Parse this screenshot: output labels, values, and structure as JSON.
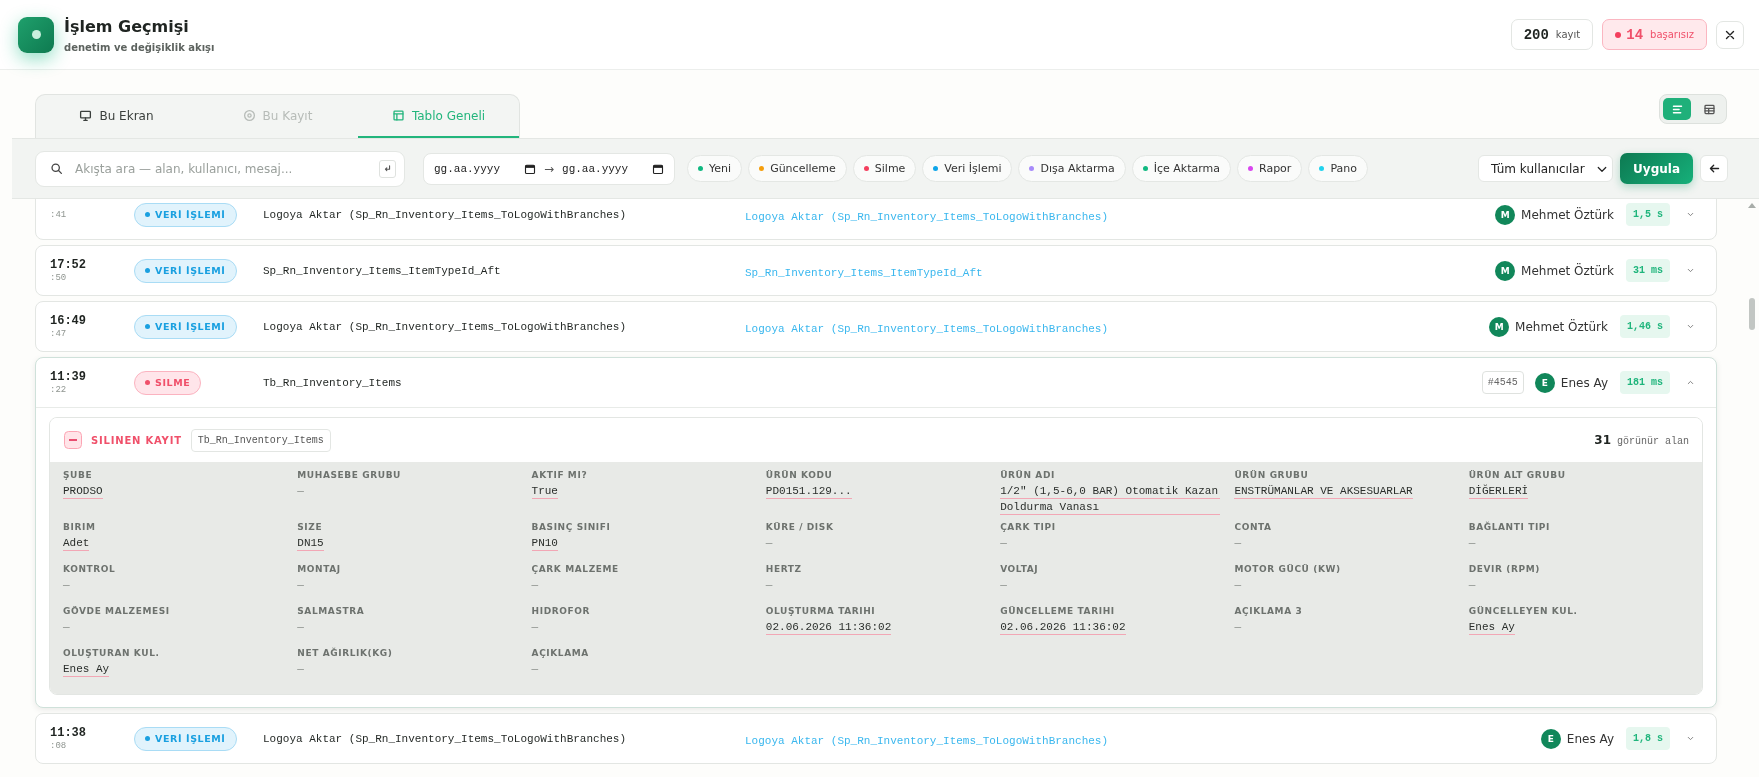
{
  "header": {
    "title": "İşlem Geçmişi",
    "subtitle": "denetim ve değişiklik akışı",
    "count": {
      "value": "200",
      "label": "kayıt"
    },
    "failed": {
      "value": "14",
      "label": "başarısız"
    }
  },
  "tabs": [
    {
      "label": "Bu Ekran",
      "selected": false,
      "disabled": false
    },
    {
      "label": "Bu Kayıt",
      "selected": false,
      "disabled": true
    },
    {
      "label": "Tablo Geneli",
      "selected": true,
      "disabled": false
    }
  ],
  "view_toggle": [
    {
      "selected": true
    },
    {
      "selected": false
    }
  ],
  "filters": {
    "search": {
      "placeholder": "Akışta ara — alan, kullanıcı, mesaj..."
    },
    "date_from": {
      "placeholder": "gg.aa.yyyy"
    },
    "date_separator": "→",
    "date_to": {
      "placeholder": "gg.aa.yyyy"
    },
    "chips": [
      {
        "label": "Yeni",
        "color": "#10b981"
      },
      {
        "label": "Güncelleme",
        "color": "#f59e0b"
      },
      {
        "label": "Silme",
        "color": "#f43f5e"
      },
      {
        "label": "Veri İşlemi",
        "color": "#0ea5e9"
      },
      {
        "label": "Dışa Aktarma",
        "color": "#a78bfa"
      },
      {
        "label": "İçe Aktarma",
        "color": "#10b981"
      },
      {
        "label": "Rapor",
        "color": "#d946ef"
      },
      {
        "label": "Pano",
        "color": "#22d3ee"
      }
    ],
    "user_select": "Tüm kullanıcılar",
    "apply_button": "Uygula"
  },
  "rows": [
    {
      "seconds": ":41",
      "kind": "data",
      "badge": "VERİ İŞLEMİ",
      "name": "Logoya Aktar (Sp_Rn_Inventory_Items_ToLogoWithBranches)",
      "link": "Logoya Aktar (Sp_Rn_Inventory_Items_ToLogoWithBranches)",
      "avatar": "M",
      "user": "Mehmet Öztürk",
      "duration": "1,5 s",
      "expanded": false
    },
    {
      "time": "17:52",
      "seconds": ":50",
      "kind": "data",
      "badge": "VERİ İŞLEMİ",
      "name": "Sp_Rn_Inventory_Items_ItemTypeId_Aft",
      "link": "Sp_Rn_Inventory_Items_ItemTypeId_Aft",
      "avatar": "M",
      "user": "Mehmet Öztürk",
      "duration": "31 ms",
      "expanded": false
    },
    {
      "time": "16:49",
      "seconds": ":47",
      "kind": "data",
      "badge": "VERİ İŞLEMİ",
      "name": "Logoya Aktar (Sp_Rn_Inventory_Items_ToLogoWithBranches)",
      "link": "Logoya Aktar (Sp_Rn_Inventory_Items_ToLogoWithBranches)",
      "avatar": "M",
      "user": "Mehmet Öztürk",
      "duration": "1,46 s",
      "expanded": false
    },
    {
      "time": "11:39",
      "seconds": ":22",
      "kind": "delete",
      "badge": "SILME",
      "name": "Tb_Rn_Inventory_Items",
      "record_id": "#4545",
      "avatar": "E",
      "user": "Enes Ay",
      "duration": "181 ms",
      "expanded": true,
      "detail": {
        "title": "SILINEN KAYIT",
        "table": "Tb_Rn_Inventory_Items",
        "field_count": "31",
        "field_count_label": "görünür alan",
        "fields": [
          {
            "label": "ŞUBE",
            "value": "PRODSO",
            "struck": true
          },
          {
            "label": "MUHASEBE GRUBU",
            "value": "—",
            "struck": false
          },
          {
            "label": "AKTIF MI?",
            "value": "True",
            "struck": true
          },
          {
            "label": "ÜRÜN KODU",
            "value": "PD0151.129...",
            "struck": true
          },
          {
            "label": "ÜRÜN ADI",
            "value": "1/2″ (1,5-6,0 BAR) Otomatik Kazan Doldurma Vanası",
            "struck": true
          },
          {
            "label": "ÜRÜN GRUBU",
            "value": "ENSTRÜMANLAR VE AKSESUARLAR",
            "struck": true
          },
          {
            "label": "ÜRÜN ALT GRUBU",
            "value": "DİĞERLERİ",
            "struck": true
          },
          {
            "label": "BIRIM",
            "value": "Adet",
            "struck": true
          },
          {
            "label": "SIZE",
            "value": "DN15",
            "struck": true
          },
          {
            "label": "BASINÇ SINIFI",
            "value": "PN10",
            "struck": true
          },
          {
            "label": "KÜRE / DISK",
            "value": "—",
            "struck": false
          },
          {
            "label": "ÇARK TIPI",
            "value": "—",
            "struck": false
          },
          {
            "label": "CONTA",
            "value": "—",
            "struck": false
          },
          {
            "label": "BAĞLANTI TIPI",
            "value": "—",
            "struck": false
          },
          {
            "label": "KONTROL",
            "value": "—",
            "struck": false
          },
          {
            "label": "MONTAJ",
            "value": "—",
            "struck": false
          },
          {
            "label": "ÇARK MALZEME",
            "value": "—",
            "struck": false
          },
          {
            "label": "HERTZ",
            "value": "—",
            "struck": false
          },
          {
            "label": "VOLTAJ",
            "value": "—",
            "struck": false
          },
          {
            "label": "MOTOR GÜCÜ (KW)",
            "value": "—",
            "struck": false
          },
          {
            "label": "DEVIR (RPM)",
            "value": "—",
            "struck": false
          },
          {
            "label": "GÖVDE MALZEMESI",
            "value": "—",
            "struck": false
          },
          {
            "label": "SALMASTRA",
            "value": "—",
            "struck": false
          },
          {
            "label": "HIDROFOR",
            "value": "—",
            "struck": false
          },
          {
            "label": "OLUŞTURMA TARIHI",
            "value": "02.06.2026 11:36:02",
            "struck": true
          },
          {
            "label": "GÜNCELLEME TARIHI",
            "value": "02.06.2026 11:36:02",
            "struck": true
          },
          {
            "label": "AÇIKLAMA 3",
            "value": "—",
            "struck": false
          },
          {
            "label": "GÜNCELLEYEN KUL.",
            "value": "Enes Ay",
            "struck": true
          },
          {
            "label": "OLUŞTURAN KUL.",
            "value": "Enes Ay",
            "struck": true
          },
          {
            "label": "NET AĞIRLIK(KG)",
            "value": "—",
            "struck": false
          },
          {
            "label": "AÇIKLAMA",
            "value": "—",
            "struck": false
          }
        ]
      }
    },
    {
      "time": "11:38",
      "seconds": ":08",
      "kind": "data",
      "badge": "VERİ İŞLEMİ",
      "name": "Logoya Aktar (Sp_Rn_Inventory_Items_ToLogoWithBranches)",
      "link": "Logoya Aktar (Sp_Rn_Inventory_Items_ToLogoWithBranches)",
      "avatar": "E",
      "user": "Enes Ay",
      "duration": "1,8 s",
      "expanded": false
    }
  ]
}
